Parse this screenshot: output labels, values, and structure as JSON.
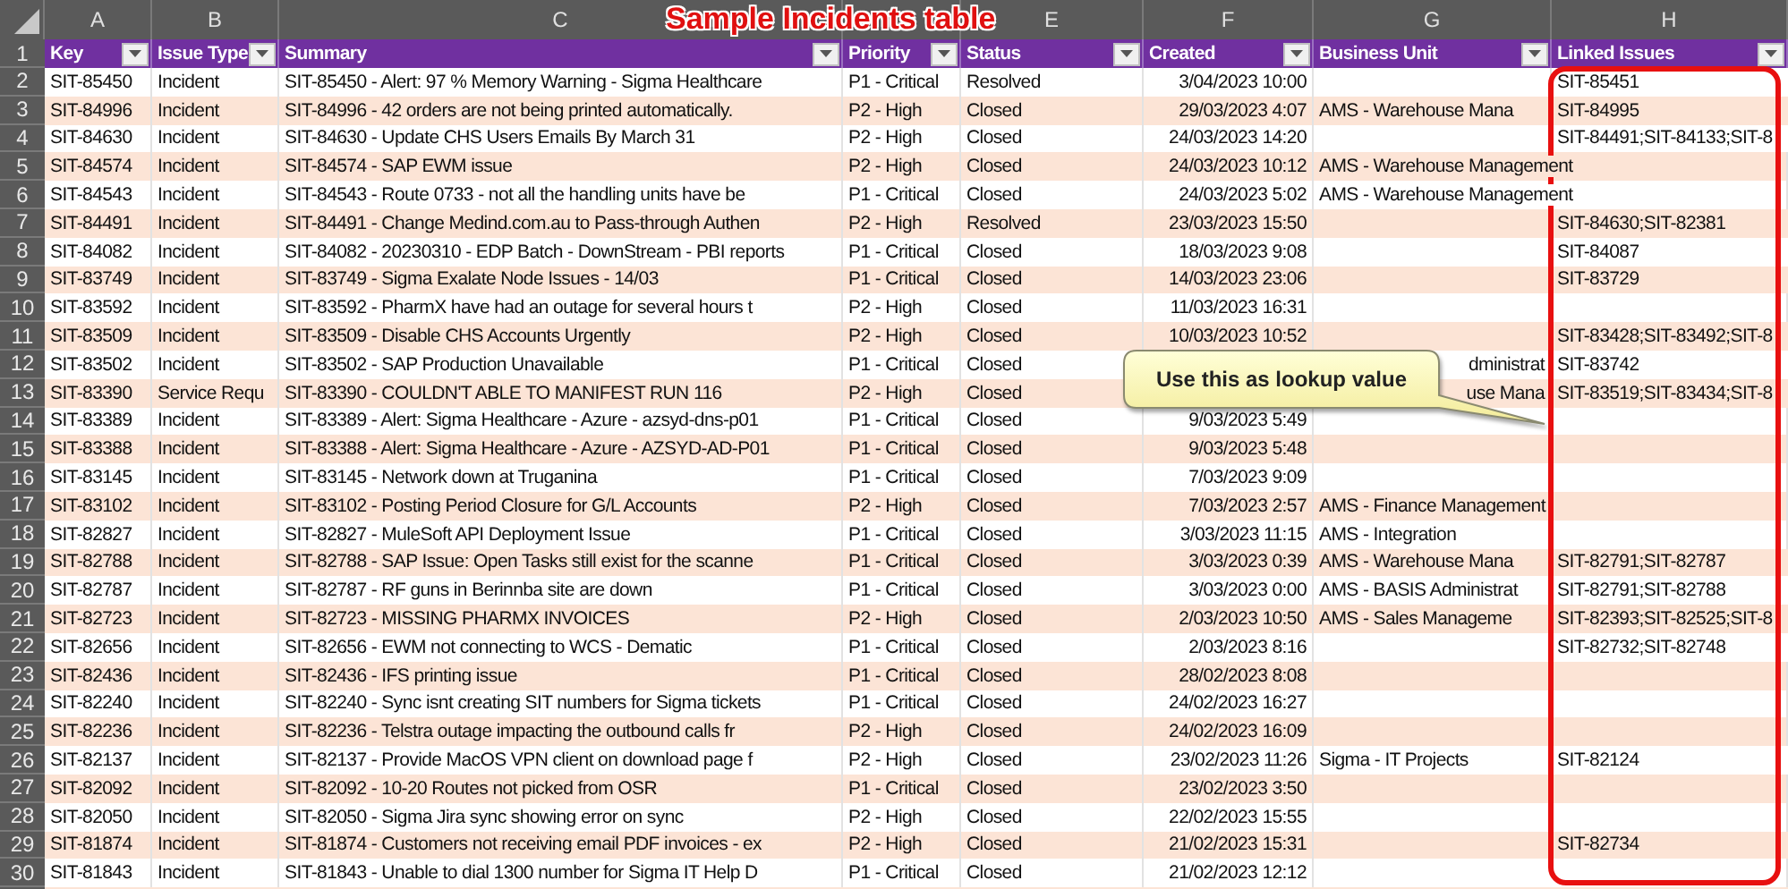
{
  "sheet_title": "Sample Incidents table",
  "columns": [
    {
      "letter": "A",
      "header": "Key"
    },
    {
      "letter": "B",
      "header": "Issue Type"
    },
    {
      "letter": "C",
      "header": "Summary"
    },
    {
      "header": "Priority"
    },
    {
      "letter": "E",
      "header": "Status"
    },
    {
      "letter": "F",
      "header": "Created"
    },
    {
      "letter": "G",
      "header": "Business Unit"
    },
    {
      "letter": "H",
      "header": "Linked Issues"
    }
  ],
  "header_row_number": "1",
  "rows": [
    {
      "row_number": "2",
      "key": "SIT-85450",
      "issue_type": "Incident",
      "summary": "SIT-85450 - Alert: 97 % Memory Warning - Sigma Healthcare",
      "priority": "P1 - Critical",
      "status": "Resolved",
      "created": "3/04/2023 10:00",
      "linked_issues": "SIT-85451"
    },
    {
      "row_number": "3",
      "key": "SIT-84996",
      "issue_type": "Incident",
      "summary": "SIT-84996 - 42 orders are not being printed automatically.",
      "priority": "P2 - High",
      "status": "Closed",
      "created": "29/03/2023 4:07",
      "business_unit": "AMS - Warehouse Mana",
      "linked_issues": "SIT-84995"
    },
    {
      "row_number": "4",
      "key": "SIT-84630",
      "issue_type": "Incident",
      "summary": "SIT-84630 - Update CHS Users Emails By March 31",
      "priority": "P2 - High",
      "status": "Closed",
      "created": "24/03/2023 14:20",
      "linked_issues": "SIT-84491;SIT-84133;SIT-8"
    },
    {
      "row_number": "5",
      "key": "SIT-84574",
      "issue_type": "Incident",
      "summary": "SIT-84574 - SAP EWM issue",
      "priority": "P2 - High",
      "status": "Closed",
      "created": "24/03/2023 10:12",
      "business_unit": "AMS - Warehouse Management"
    },
    {
      "row_number": "6",
      "key": "SIT-84543",
      "issue_type": "Incident",
      "summary": "SIT-84543 - Route 0733 - not all the handling units have be",
      "priority": "P1 - Critical",
      "status": "Closed",
      "created": "24/03/2023 5:02",
      "business_unit": "AMS - Warehouse Management"
    },
    {
      "row_number": "7",
      "key": "SIT-84491",
      "issue_type": "Incident",
      "summary": "SIT-84491 - Change Medind.com.au to Pass-through Authen",
      "priority": "P2 - High",
      "status": "Resolved",
      "created": "23/03/2023 15:50",
      "linked_issues": "SIT-84630;SIT-82381"
    },
    {
      "row_number": "8",
      "key": "SIT-84082",
      "issue_type": "Incident",
      "summary": "SIT-84082 - 20230310 - EDP Batch - DownStream - PBI reports",
      "priority": "P1 - Critical",
      "status": "Closed",
      "created": "18/03/2023 9:08",
      "linked_issues": "SIT-84087"
    },
    {
      "row_number": "9",
      "key": "SIT-83749",
      "issue_type": "Incident",
      "summary": "SIT-83749 - Sigma Exalate Node Issues - 14/03",
      "priority": "P1 - Critical",
      "status": "Closed",
      "created": "14/03/2023 23:06",
      "linked_issues": "SIT-83729"
    },
    {
      "row_number": "10",
      "key": "SIT-83592",
      "issue_type": "Incident",
      "summary": "SIT-83592 - PharmX have had an outage for several hours t",
      "priority": "P2 - High",
      "status": "Closed",
      "created": "11/03/2023 16:31"
    },
    {
      "row_number": "11",
      "key": "SIT-83509",
      "issue_type": "Incident",
      "summary": "SIT-83509 - Disable CHS Accounts Urgently",
      "priority": "P2 - High",
      "status": "Closed",
      "created": "10/03/2023 10:52",
      "linked_issues": "SIT-83428;SIT-83492;SIT-8"
    },
    {
      "row_number": "12",
      "key": "SIT-83502",
      "issue_type": "Incident",
      "summary": "SIT-83502 - SAP Production Unavailable",
      "priority": "P1 - Critical",
      "status": "Closed",
      "business_unit": "dministrat",
      "partly_covered": true,
      "linked_issues": "SIT-83742"
    },
    {
      "row_number": "13",
      "key": "SIT-83390",
      "issue_type": "Service Requ",
      "summary": "SIT-83390 - COULDN'T ABLE TO MANIFEST RUN 116",
      "priority": "P2 - High",
      "status": "Closed",
      "business_unit": "use Mana",
      "partly_covered": true,
      "linked_issues": "SIT-83519;SIT-83434;SIT-8"
    },
    {
      "row_number": "14",
      "key": "SIT-83389",
      "issue_type": "Incident",
      "summary": "SIT-83389 - Alert: Sigma Healthcare - Azure - azsyd-dns-p01",
      "priority": "P1 - Critical",
      "status": "Closed",
      "created": "9/03/2023 5:49"
    },
    {
      "row_number": "15",
      "key": "SIT-83388",
      "issue_type": "Incident",
      "summary": "SIT-83388 - Alert: Sigma Healthcare - Azure - AZSYD-AD-P01",
      "priority": "P1 - Critical",
      "status": "Closed",
      "created": "9/03/2023 5:48"
    },
    {
      "row_number": "16",
      "key": "SIT-83145",
      "issue_type": "Incident",
      "summary": "SIT-83145 - Network down at Truganina",
      "priority": "P1 - Critical",
      "status": "Closed",
      "created": "7/03/2023 9:09"
    },
    {
      "row_number": "17",
      "key": "SIT-83102",
      "issue_type": "Incident",
      "summary": "SIT-83102 - Posting Period Closure for G/L Accounts",
      "priority": "P2 - High",
      "status": "Closed",
      "created": "7/03/2023 2:57",
      "business_unit": "AMS - Finance Management"
    },
    {
      "row_number": "18",
      "key": "SIT-82827",
      "issue_type": "Incident",
      "summary": "SIT-82827 - MuleSoft API Deployment Issue",
      "priority": "P1 - Critical",
      "status": "Closed",
      "created": "3/03/2023 11:15",
      "business_unit": "AMS - Integration"
    },
    {
      "row_number": "19",
      "key": "SIT-82788",
      "issue_type": "Incident",
      "summary": "SIT-82788 - SAP Issue: Open Tasks still exist for the scanne",
      "priority": "P1 - Critical",
      "status": "Closed",
      "created": "3/03/2023 0:39",
      "business_unit": "AMS - Warehouse Mana",
      "linked_issues": "SIT-82791;SIT-82787"
    },
    {
      "row_number": "20",
      "key": "SIT-82787",
      "issue_type": "Incident",
      "summary": "SIT-82787 - RF guns in Berinnba site are down",
      "priority": "P1 - Critical",
      "status": "Closed",
      "created": "3/03/2023 0:00",
      "business_unit": "AMS - BASIS Administrat",
      "linked_issues": "SIT-82791;SIT-82788"
    },
    {
      "row_number": "21",
      "key": "SIT-82723",
      "issue_type": "Incident",
      "summary": "SIT-82723 - MISSING PHARMX INVOICES",
      "priority": "P2 - High",
      "status": "Closed",
      "created": "2/03/2023 10:50",
      "business_unit": "AMS - Sales Manageme",
      "linked_issues": "SIT-82393;SIT-82525;SIT-8"
    },
    {
      "row_number": "22",
      "key": "SIT-82656",
      "issue_type": "Incident",
      "summary": "SIT-82656 - EWM not connecting to WCS - Dematic",
      "priority": "P1 - Critical",
      "status": "Closed",
      "created": "2/03/2023 8:16",
      "linked_issues": "SIT-82732;SIT-82748"
    },
    {
      "row_number": "23",
      "key": "SIT-82436",
      "issue_type": "Incident",
      "summary": "SIT-82436 - IFS printing issue",
      "priority": "P1 - Critical",
      "status": "Closed",
      "created": "28/02/2023 8:08"
    },
    {
      "row_number": "24",
      "key": "SIT-82240",
      "issue_type": "Incident",
      "summary": "SIT-82240 - Sync isnt creating SIT numbers for Sigma tickets",
      "priority": "P1 - Critical",
      "status": "Closed",
      "created": "24/02/2023 16:27"
    },
    {
      "row_number": "25",
      "key": "SIT-82236",
      "issue_type": "Incident",
      "summary": "SIT-82236 - Telstra outage impacting the outbound calls fr",
      "priority": "P2 - High",
      "status": "Closed",
      "created": "24/02/2023 16:09"
    },
    {
      "row_number": "26",
      "key": "SIT-82137",
      "issue_type": "Incident",
      "summary": "SIT-82137 - Provide MacOS VPN client on download page f",
      "priority": "P2 - High",
      "status": "Closed",
      "created": "23/02/2023 11:26",
      "business_unit": "Sigma - IT Projects",
      "linked_issues": "SIT-82124"
    },
    {
      "row_number": "27",
      "key": "SIT-82092",
      "issue_type": "Incident",
      "summary": "SIT-82092 - 10-20 Routes not picked from OSR",
      "priority": "P1 - Critical",
      "status": "Closed",
      "created": "23/02/2023 3:50"
    },
    {
      "row_number": "28",
      "key": "SIT-82050",
      "issue_type": "Incident",
      "summary": "SIT-82050 - Sigma Jira sync showing error on sync",
      "priority": "P2 - High",
      "status": "Closed",
      "created": "22/02/2023 15:55"
    },
    {
      "row_number": "29",
      "key": "SIT-81874",
      "issue_type": "Incident",
      "summary": "SIT-81874 - Customers not receiving email PDF invoices - ex",
      "priority": "P2 - High",
      "status": "Closed",
      "created": "21/02/2023 15:31",
      "linked_issues": "SIT-82734"
    },
    {
      "row_number": "30",
      "key": "SIT-81843",
      "issue_type": "Incident",
      "summary": "SIT-81843 - Unable to dial 1300 number for Sigma IT Help D",
      "priority": "P1 - Critical",
      "status": "Closed",
      "created": "21/02/2023 12:12"
    }
  ],
  "callout": {
    "text": "Use this as lookup value"
  },
  "linked_issues_highlighted": true
}
